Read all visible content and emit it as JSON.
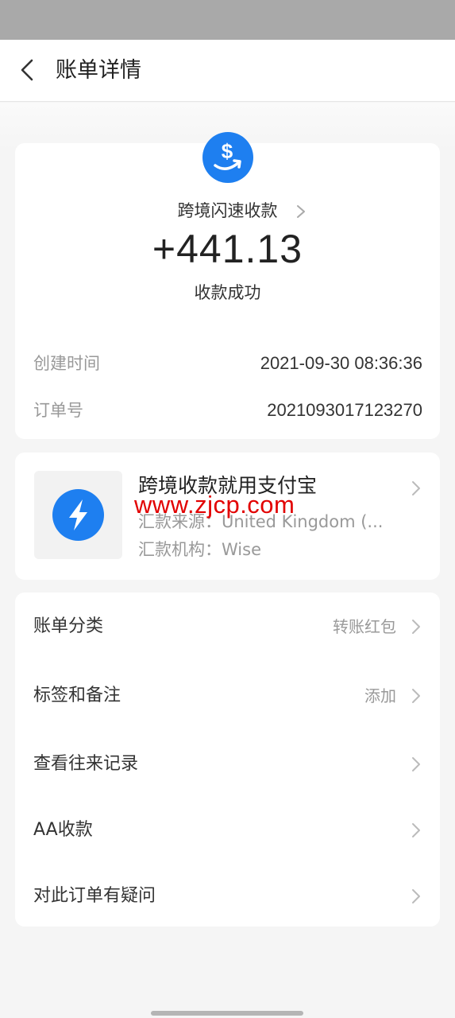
{
  "nav": {
    "title": "账单详情"
  },
  "summary": {
    "icon": "dollar-transfer-icon",
    "service_name": "跨境闪速收款",
    "amount": "+441.13",
    "status": "收款成功",
    "details": [
      {
        "label": "创建时间",
        "value": "2021-09-30 08:36:36"
      },
      {
        "label": "订单号",
        "value": "2021093017123270"
      }
    ]
  },
  "promo": {
    "icon": "lightning-icon",
    "title": "跨境收款就用支付宝",
    "source": "汇款来源：United Kingdom (...",
    "institution": "汇款机构：Wise",
    "watermark": "www.zjcp.com"
  },
  "menu": [
    {
      "label": "账单分类",
      "value": "转账红包"
    },
    {
      "label": "标签和备注",
      "value": "添加"
    },
    {
      "label": "查看往来记录",
      "value": ""
    },
    {
      "label": "AA收款",
      "value": ""
    },
    {
      "label": "对此订单有疑问",
      "value": ""
    }
  ],
  "colors": {
    "accent": "#1e7ff0",
    "watermark": "#e20000",
    "background": "#f5f5f5"
  }
}
